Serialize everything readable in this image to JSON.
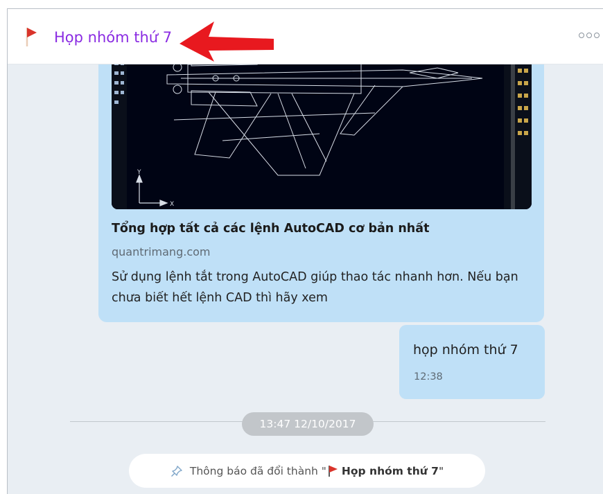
{
  "header": {
    "title": "Họp nhóm thứ 7",
    "flag_icon": "red-flag-icon",
    "more_icon": "more-options-icon"
  },
  "link_card": {
    "title": "Tổng hợp tất cả các lệnh AutoCAD cơ bản nhất",
    "domain": "quantrimang.com",
    "description": "Sử dụng lệnh tắt trong AutoCAD giúp thao tác nhanh hơn. Nếu bạn chưa biết hết lệnh CAD thì hãy xem",
    "thumbnail_axis_y": "Y",
    "thumbnail_axis_x": "X"
  },
  "message": {
    "text": "họp nhóm thứ 7",
    "time": "12:38"
  },
  "date_divider": "13:47 12/10/2017",
  "notice": {
    "prefix": "Thông báo đã đổi thành \"",
    "group_name": "Họp nhóm thứ 7",
    "suffix": "\"",
    "pin_icon": "pin-icon"
  },
  "colors": {
    "title": "#8a2be2",
    "bubble": "#bfe0f7",
    "background": "#e9eef3",
    "flag": "#d9342b",
    "arrow": "#e8191f"
  }
}
